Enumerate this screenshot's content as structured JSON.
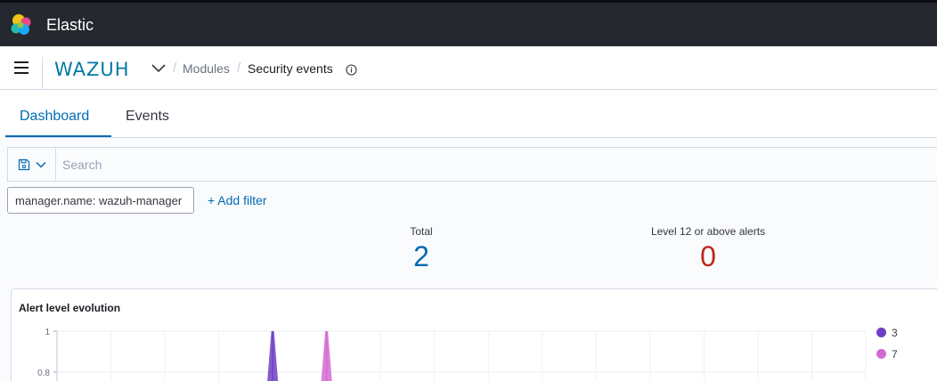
{
  "topbar": {
    "app_title": "Elastic"
  },
  "header": {
    "brand": "WAZUH",
    "breadcrumb_sep": "/",
    "breadcrumb_modules": "Modules",
    "breadcrumb_current": "Security events"
  },
  "tabs": [
    {
      "label": "Dashboard",
      "active": true
    },
    {
      "label": "Events",
      "active": false
    }
  ],
  "search": {
    "placeholder": "Search",
    "value": ""
  },
  "filters": {
    "pill": "manager.name: wazuh-manager",
    "add_label": "+ Add filter"
  },
  "stats": {
    "total_label": "Total",
    "total_value": "2",
    "level_label": "Level 12 or above alerts",
    "level_value": "0"
  },
  "colors": {
    "accent": "#006bb4",
    "danger": "#bd271e",
    "series_3": "#6e3fc5",
    "series_7": "#d36ad0"
  },
  "chart_data": {
    "type": "area",
    "title": "Alert level evolution",
    "y_ticks": [
      "1",
      "0.8"
    ],
    "ylim": [
      0,
      1
    ],
    "grid": true,
    "legend_placement": "right",
    "series": [
      {
        "name": "3",
        "color": "#6e3fc5",
        "peak_index": 4,
        "values_visible": [
          0,
          0,
          0,
          0,
          1,
          0,
          0,
          0,
          0,
          0,
          0,
          0,
          0,
          0,
          0
        ]
      },
      {
        "name": "7",
        "color": "#d36ad0",
        "peak_index": 5,
        "values_visible": [
          0,
          0,
          0,
          0,
          0,
          1,
          0,
          0,
          0,
          0,
          0,
          0,
          0,
          0,
          0
        ]
      }
    ]
  }
}
